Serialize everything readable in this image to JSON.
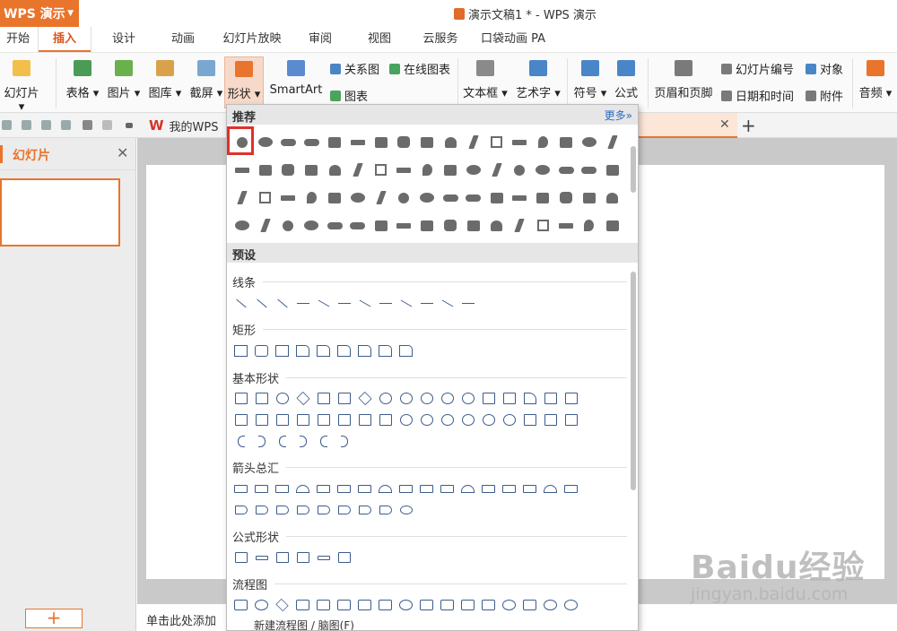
{
  "window": {
    "app_button_label": "WPS 演示",
    "doc_title": "演示文稿1 * - WPS 演示"
  },
  "ribbon_tabs": [
    {
      "label": "开始"
    },
    {
      "label": "插入"
    },
    {
      "label": "设计"
    },
    {
      "label": "动画"
    },
    {
      "label": "幻灯片放映"
    },
    {
      "label": "审阅"
    },
    {
      "label": "视图"
    },
    {
      "label": "云服务"
    },
    {
      "label": "口袋动画 PA"
    }
  ],
  "active_tab": "插入",
  "ribbon": {
    "new_slide": "幻灯片",
    "table": "表格",
    "picture": "图片",
    "gallery": "图库",
    "screenshot": "截屏",
    "shapes": "形状",
    "smartart": "SmartArt",
    "relation_chart": "关系图",
    "online_chart": "在线图表",
    "chart": "图表",
    "textbox": "文本框",
    "art_text": "艺术字",
    "symbol": "符号",
    "formula": "公式",
    "header_footer": "页眉和页脚",
    "slide_number": "幻灯片编号",
    "object": "对象",
    "date_time": "日期和时间",
    "attachment": "附件",
    "audio": "音频"
  },
  "quick_bar": {
    "wps_tab_label": "我的WPS"
  },
  "left_panel": {
    "title": "幻灯片",
    "add_button": "+"
  },
  "notes": {
    "placeholder": "单击此处添加"
  },
  "shapes_panel": {
    "recommended_title": "推荐",
    "more_link": "更多»",
    "preset_title": "预设",
    "categories": [
      "线条",
      "矩形",
      "基本形状",
      "箭头总汇",
      "公式形状",
      "流程图"
    ],
    "bottom_command": "新建流程图 / 脑图(F)"
  },
  "watermark": {
    "brand": "Baidu经验",
    "url": "jingyan.baidu.com"
  },
  "colors": {
    "accent": "#e9742c",
    "selection": "#e0302b",
    "outline_shape": "#3b5c8c"
  }
}
